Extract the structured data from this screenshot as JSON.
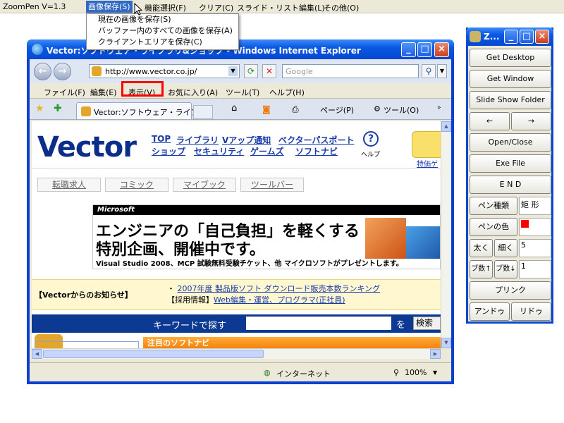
{
  "zoompen_menu": {
    "app_version": "ZoomPen V=1.3",
    "items": [
      "画像保存(S)",
      "機能選択(F)",
      "クリア(C)",
      "スライド・リスト編集(L)",
      "その他(O)"
    ],
    "selected_index": 0
  },
  "image_save_dropdown": {
    "items": [
      "現在の画像を保存(S)",
      "バッファー内のすべての画像を保存(A)",
      "クライアントエリアを保存(C)"
    ]
  },
  "ie_window": {
    "title": "Vector:ソフトウェア・ライブラリ&ショップ - Windows Internet Explorer",
    "address": "http://www.vector.co.jp/",
    "search_placeholder": "Google",
    "menu": [
      "ファイル(F)",
      "編集(E)",
      "表示(V)",
      "お気に入り(A)",
      "ツール(T)",
      "ヘルプ(H)"
    ],
    "highlighted_menu_index": 2,
    "tab_title": "Vector:ソフトウェア・ライブラ...",
    "toolbar": {
      "page": "ページ(P)",
      "tools": "ツール(O)"
    },
    "status": {
      "zone": "インターネット",
      "zoom": "100%"
    }
  },
  "page": {
    "logo": "Vector",
    "links_row1": [
      "TOP",
      "ライブラリ",
      "Vアップ通知",
      "ベクターパスポート"
    ],
    "links_row2": [
      "ショップ",
      "セキュリティ",
      "ゲームズ",
      "ソフトナビ"
    ],
    "help": "ヘルプ",
    "tokusha": "特価ゲ",
    "pills": [
      "転職求人",
      "コミック",
      "マイブック",
      "ツールバー"
    ],
    "banner": {
      "brand": "Microsoft",
      "line1": "エンジニアの「自己負担」を軽くする",
      "line2": "特別企画、開催中です。",
      "bottom": "Visual Studio 2008、MCP 試験無料受験チケット、他 マイクロソフトがプレゼントします。"
    },
    "notice": {
      "label": "【Vectorからのお知らせ】",
      "item1": "2007年度 製品版ソフト ダウンロード販売本数ランキング",
      "item2_prefix": "【採用情報】",
      "item2_link": "Web編集・運営、プログラマ(正社員)"
    },
    "keyword": {
      "label": "キーワードで探す",
      "wo": "を",
      "button": "検索"
    },
    "navi": "注目のソフトナビ"
  },
  "palette": {
    "title": "Z...",
    "buttons": {
      "get_desktop": "Get Desktop",
      "get_window": "Get Window",
      "slide_show": "Slide Show Folder",
      "left": "←",
      "right": "→",
      "open_close": "Open/Close",
      "exe_file": "Exe File",
      "end": "E N D",
      "pen_type": "ペン種類",
      "pen_color": "ペンの色",
      "thick": "太く",
      "thin": "細く",
      "count_up": "ブ数↑",
      "count_down": "ブ数↓",
      "print": "プリンク",
      "undo": "アンドゥ",
      "redo": "リドゥ"
    },
    "pen_type_value": "矩 形",
    "width_value": "5",
    "count_value": "1",
    "pen_color_value": "#ff0000"
  }
}
